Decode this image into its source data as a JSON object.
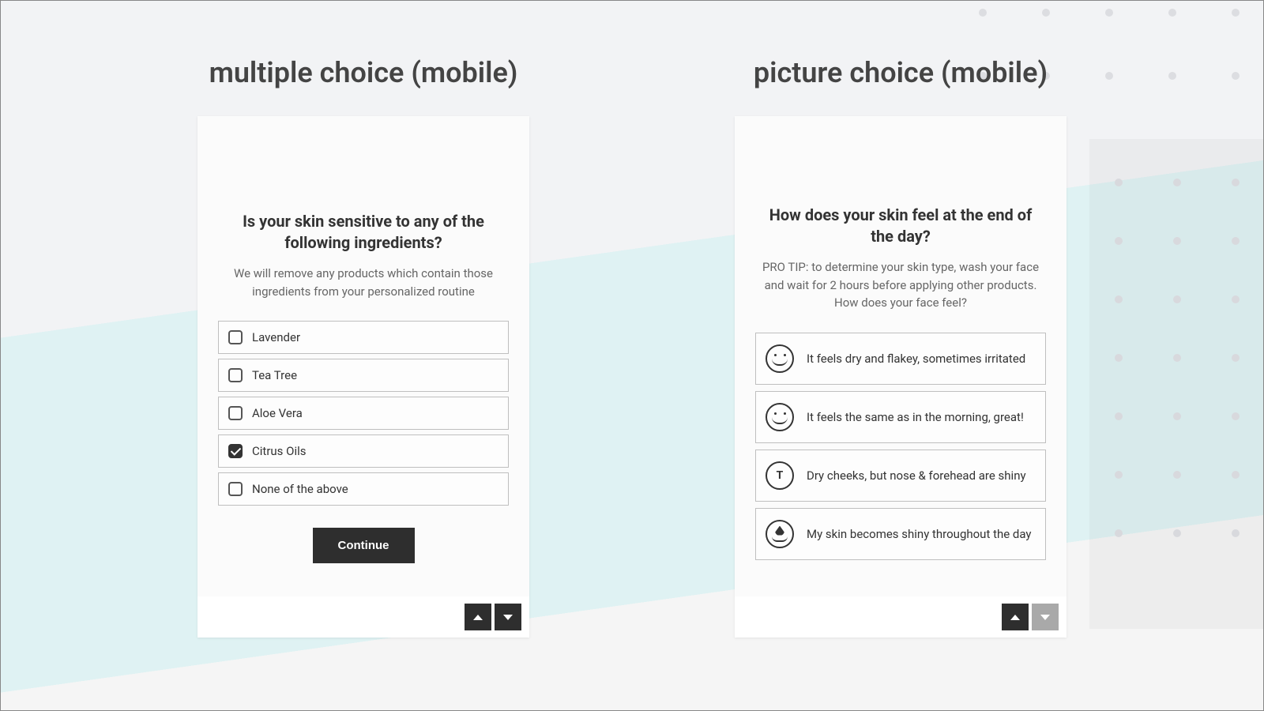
{
  "left": {
    "title": "multiple choice (mobile)",
    "question": "Is your skin sensitive to any of the following ingredients?",
    "subtitle": "We will remove any products which contain those ingredients from your personalized routine",
    "options": [
      {
        "label": "Lavender",
        "checked": false
      },
      {
        "label": "Tea Tree",
        "checked": false
      },
      {
        "label": "Aloe Vera",
        "checked": false
      },
      {
        "label": "Citrus Oils",
        "checked": true
      },
      {
        "label": "None of the above",
        "checked": false
      }
    ],
    "continue_label": "Continue",
    "nav": {
      "up_enabled": true,
      "down_enabled": true
    }
  },
  "right": {
    "title": "picture choice (mobile)",
    "question": "How does your skin feel at the end of the day?",
    "subtitle": "PRO TIP: to determine your skin type, wash your face and wait for 2 hours before applying other products. How does your face feel?",
    "options": [
      {
        "label": "It feels dry and flakey, sometimes irritated",
        "icon": "face-dry"
      },
      {
        "label": "It feels the same as in the morning, great!",
        "icon": "face-same"
      },
      {
        "label": "Dry cheeks, but nose & forehead are shiny",
        "icon": "tzone"
      },
      {
        "label": "My skin becomes shiny throughout the day",
        "icon": "drop"
      }
    ],
    "nav": {
      "up_enabled": true,
      "down_enabled": false
    }
  }
}
